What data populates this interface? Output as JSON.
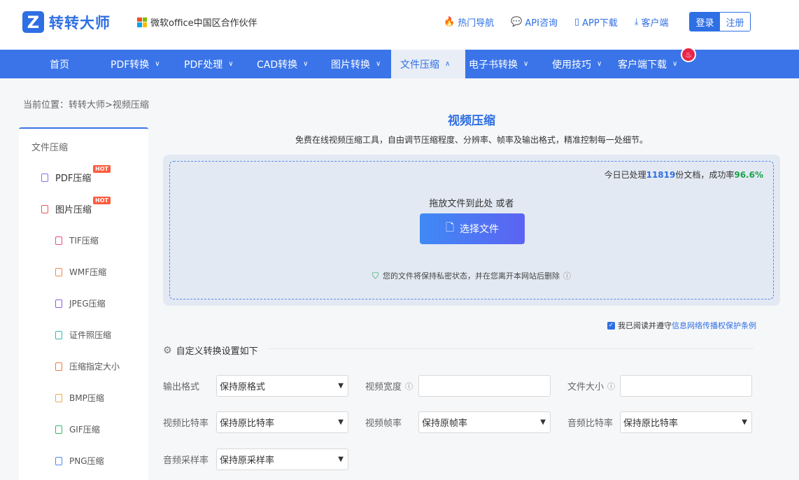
{
  "header": {
    "logo_mark": "Z",
    "logo_text": "转转大师",
    "partner": "微软office中国区合作伙伴",
    "links": [
      {
        "icon": "fire-icon",
        "label": "热门导航"
      },
      {
        "icon": "chat-icon",
        "label": "API咨询"
      },
      {
        "icon": "phone-icon",
        "label": "APP下载"
      },
      {
        "icon": "download-icon",
        "label": "客户端"
      }
    ],
    "login": "登录",
    "register": "注册"
  },
  "nav": {
    "items": [
      {
        "label": "首页",
        "chevron": ""
      },
      {
        "label": "PDF转换",
        "chevron": "∨"
      },
      {
        "label": "PDF处理",
        "chevron": "∨"
      },
      {
        "label": "CAD转换",
        "chevron": "∨"
      },
      {
        "label": "图片转换",
        "chevron": "∨"
      },
      {
        "label": "文件压缩",
        "chevron": "∧"
      },
      {
        "label": "电子书转换",
        "chevron": "∨"
      },
      {
        "label": "使用技巧",
        "chevron": "∨"
      },
      {
        "label": "客户端下载",
        "chevron": "∨"
      }
    ],
    "active_index": 5
  },
  "breadcrumb": "当前位置：转转大师>视频压缩",
  "sidebar": {
    "title": "文件压缩",
    "items": [
      {
        "label": "PDF压缩",
        "badge": "HOT",
        "color": "#8a6ee8"
      },
      {
        "label": "图片压缩",
        "badge": "HOT",
        "color": "#e8565a"
      },
      {
        "label": "TIF压缩",
        "badge": "",
        "color": "#e84b8a"
      },
      {
        "label": "WMF压缩",
        "badge": "",
        "color": "#f08a4b"
      },
      {
        "label": "JPEG压缩",
        "badge": "",
        "color": "#8a5ce8"
      },
      {
        "label": "证件照压缩",
        "badge": "",
        "color": "#2fb9b0"
      },
      {
        "label": "压缩指定大小",
        "badge": "",
        "color": "#f07a3a"
      },
      {
        "label": "BMP压缩",
        "badge": "",
        "color": "#f0a84b"
      },
      {
        "label": "GIF压缩",
        "badge": "",
        "color": "#2fb96a"
      },
      {
        "label": "PNG压缩",
        "badge": "",
        "color": "#4b8af0"
      }
    ]
  },
  "main": {
    "title": "视频压缩",
    "subtitle": "免费在线视频压缩工具，自由调节压缩程度、分辨率、帧率及输出格式，精准控制每一处细节。",
    "stats_prefix": "今日已处理",
    "stats_count": "11819",
    "stats_mid": "份文档，成功率",
    "stats_rate": "96.6%",
    "drop_text": "拖放文件到此处 或者",
    "choose_button": "选择文件",
    "privacy": "您的文件将保持私密状态，并在您离开本网站后删除",
    "agree_prefix": "我已阅读并遵守",
    "agree_link": "信息网络传播权保护条例",
    "settings_title": "自定义转换设置如下"
  },
  "settings": {
    "output_format": {
      "label": "输出格式",
      "value": "保持原格式"
    },
    "video_width": {
      "label": "视频宽度",
      "value": ""
    },
    "file_size": {
      "label": "文件大小",
      "value": ""
    },
    "video_bitrate": {
      "label": "视频比特率",
      "value": "保持原比特率"
    },
    "video_fps": {
      "label": "视频帧率",
      "value": "保持原帧率"
    },
    "audio_bitrate": {
      "label": "音频比特率",
      "value": "保持原比特率"
    },
    "audio_sample": {
      "label": "音频采样率",
      "value": "保持原采样率"
    }
  },
  "colors": {
    "brand": "#2f6fe4",
    "nav_bg": "#3a74e8",
    "success": "#1aa34a",
    "hot": "#ff5a3c"
  }
}
